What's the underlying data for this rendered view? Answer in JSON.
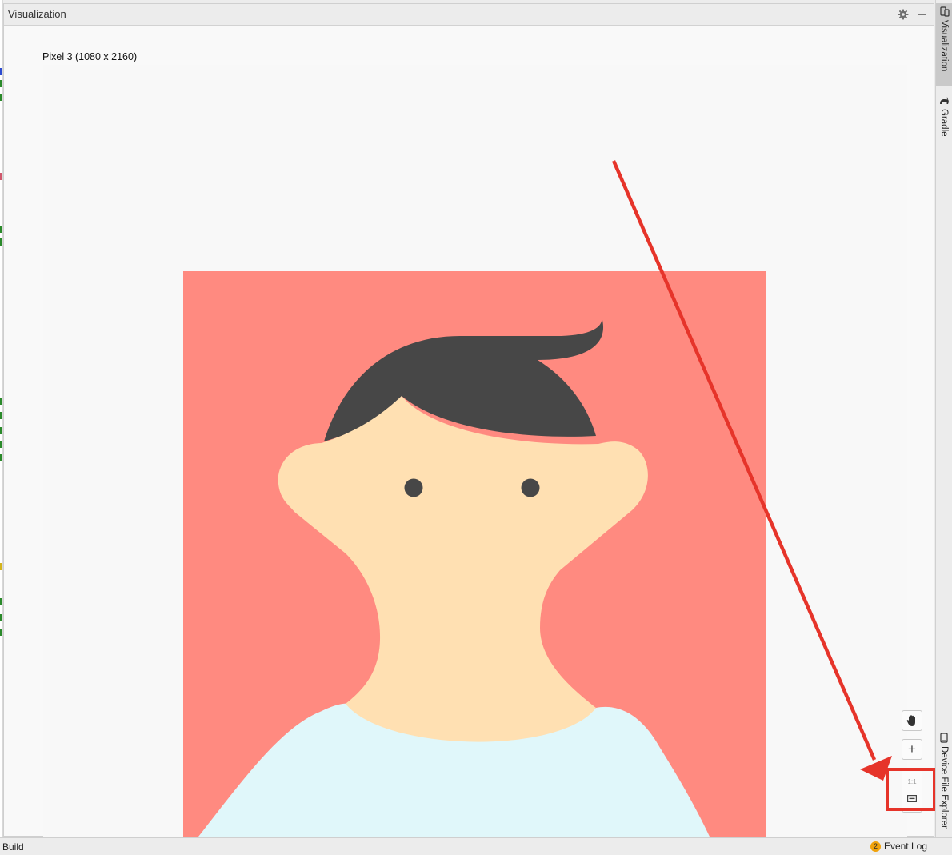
{
  "tool_window": {
    "title": "Visualization"
  },
  "preview": {
    "device_label": "Pixel 3 (1080 x 2160)"
  },
  "zoom_controls": {
    "pan_icon": "hand-icon",
    "zoom_in": "+",
    "actual_size": "1:1",
    "fit_icon": "fit-screen-icon"
  },
  "side_tabs": [
    "Visualization",
    "Gradle",
    "Device File Explorer"
  ],
  "status_bar": {
    "build": "Build",
    "event_log": "Event Log",
    "event_count": "2"
  },
  "colors": {
    "artwork_background": "#ff8a80",
    "hair": "#474747",
    "skin": "#ffe0b2",
    "shirt": "#e0f7fa",
    "annotation": "#e6342a"
  }
}
